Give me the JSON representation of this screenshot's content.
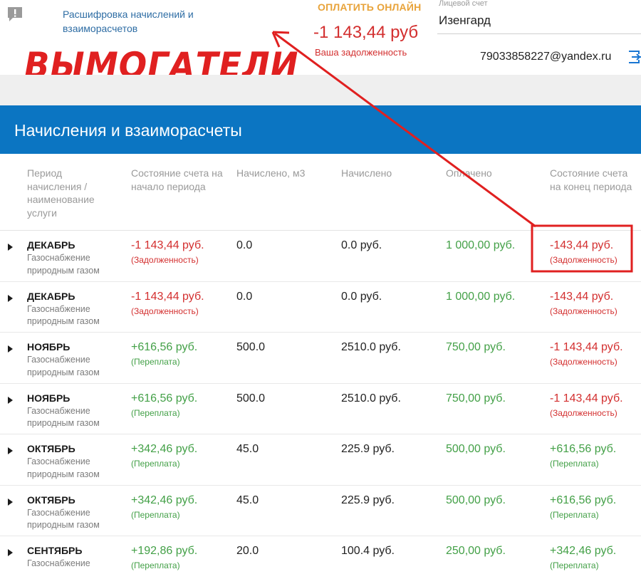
{
  "header": {
    "nav_link": "Расшифровка начислений и взаиморасчетов",
    "pay_online_label": "ОПЛАТИТЬ ОНЛАЙН",
    "debt_amount": "-1 143,44 руб",
    "debt_caption": "Ваша задолженность",
    "account_label": "Лицевой счет",
    "account_value": "Изенгард",
    "user_email": "79033858227@yandex.ru"
  },
  "overlay": {
    "caption": "ВЫМОГАТЕЛИ",
    "color": "#e02020"
  },
  "section": {
    "title": "Начисления и взаиморасчеты"
  },
  "table": {
    "columns": [
      "Период начисления / наименование услуги",
      "Состояние счета на начало периода",
      "Начислено, м3",
      "Начислено",
      "Оплачено",
      "Состояние счета на конец периода"
    ],
    "rows": [
      {
        "period": "ДЕКАБРЬ",
        "service": "Газоснабжение природным газом",
        "start": "-1 143,44 руб.",
        "start_status": "(Задолженность)",
        "start_kind": "debt",
        "volume": "0.0",
        "charged": "0.0 руб.",
        "paid": "1 000,00 руб.",
        "end": "-143,44 руб.",
        "end_status": "(Задолженность)",
        "end_kind": "debt"
      },
      {
        "period": "ДЕКАБРЬ",
        "service": "Газоснабжение природным газом",
        "start": "-1 143,44 руб.",
        "start_status": "(Задолженность)",
        "start_kind": "debt",
        "volume": "0.0",
        "charged": "0.0 руб.",
        "paid": "1 000,00 руб.",
        "end": "-143,44 руб.",
        "end_status": "(Задолженность)",
        "end_kind": "debt"
      },
      {
        "period": "НОЯБРЬ",
        "service": "Газоснабжение природным газом",
        "start": "+616,56 руб.",
        "start_status": "(Переплата)",
        "start_kind": "overpay",
        "volume": "500.0",
        "charged": "2510.0 руб.",
        "paid": "750,00 руб.",
        "end": "-1 143,44 руб.",
        "end_status": "(Задолженность)",
        "end_kind": "debt"
      },
      {
        "period": "НОЯБРЬ",
        "service": "Газоснабжение природным газом",
        "start": "+616,56 руб.",
        "start_status": "(Переплата)",
        "start_kind": "overpay",
        "volume": "500.0",
        "charged": "2510.0 руб.",
        "paid": "750,00 руб.",
        "end": "-1 143,44 руб.",
        "end_status": "(Задолженность)",
        "end_kind": "debt"
      },
      {
        "period": "ОКТЯБРЬ",
        "service": "Газоснабжение природным газом",
        "start": "+342,46 руб.",
        "start_status": "(Переплата)",
        "start_kind": "overpay",
        "volume": "45.0",
        "charged": "225.9 руб.",
        "paid": "500,00 руб.",
        "end": "+616,56 руб.",
        "end_status": "(Переплата)",
        "end_kind": "overpay"
      },
      {
        "period": "ОКТЯБРЬ",
        "service": "Газоснабжение природным газом",
        "start": "+342,46 руб.",
        "start_status": "(Переплата)",
        "start_kind": "overpay",
        "volume": "45.0",
        "charged": "225.9 руб.",
        "paid": "500,00 руб.",
        "end": "+616,56 руб.",
        "end_status": "(Переплата)",
        "end_kind": "overpay"
      },
      {
        "period": "СЕНТЯБРЬ",
        "service": "Газоснабжение природным газом",
        "start": "+192,86 руб.",
        "start_status": "(Переплата)",
        "start_kind": "overpay",
        "volume": "20.0",
        "charged": "100.4 руб.",
        "paid": "250,00 руб.",
        "end": "+342,46 руб.",
        "end_status": "(Переплата)",
        "end_kind": "overpay"
      }
    ]
  },
  "colors": {
    "brand_blue": "#0b75c2",
    "debt_red": "#d32f2f",
    "overpay_green": "#43a047",
    "pay_orange": "#e8a33a"
  },
  "icons": {
    "feedback": "feedback-icon",
    "logout": "logout-icon",
    "row_toggle": "triangle-right-icon"
  }
}
